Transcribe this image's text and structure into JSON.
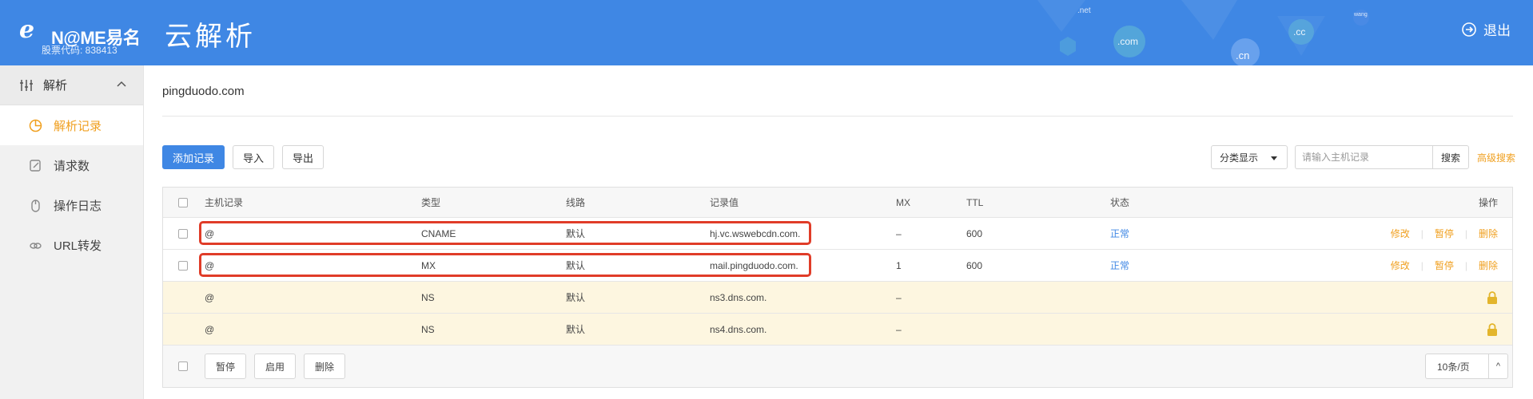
{
  "header": {
    "logo_mark": "e",
    "brand": "N@ME易名",
    "stock_code": "股票代码: 838413",
    "app_title": "云解析",
    "logout": "退出",
    "deco_tlds": [
      ".net",
      ".com",
      ".cc",
      ".cn",
      "wang"
    ]
  },
  "sidebar": {
    "group": "解析",
    "items": [
      {
        "label": "解析记录",
        "icon": "pie-chart-icon",
        "active": true
      },
      {
        "label": "请求数",
        "icon": "edit-icon",
        "active": false
      },
      {
        "label": "操作日志",
        "icon": "mouse-icon",
        "active": false
      },
      {
        "label": "URL转发",
        "icon": "link-icon",
        "active": false
      }
    ]
  },
  "main": {
    "domain": "pingduodo.com",
    "toolbar": {
      "add": "添加记录",
      "import": "导入",
      "export": "导出",
      "view_select": "分类显示",
      "search_placeholder": "请输入主机记录",
      "search": "搜索",
      "advanced": "高级搜索"
    },
    "table": {
      "headers": {
        "host": "主机记录",
        "type": "类型",
        "line": "线路",
        "value": "记录值",
        "mx": "MX",
        "ttl": "TTL",
        "status": "状态",
        "ops": "操作"
      },
      "rows": [
        {
          "host": "@",
          "type": "CNAME",
          "line": "默认",
          "value": "hj.vc.wswebcdn.com.",
          "mx": "–",
          "ttl": "600",
          "status": "正常"
        },
        {
          "host": "@",
          "type": "MX",
          "line": "默认",
          "value": "mail.pingduodo.com.",
          "mx": "1",
          "ttl": "600",
          "status": "正常"
        },
        {
          "host": "@",
          "type": "NS",
          "line": "默认",
          "value": "ns3.dns.com.",
          "mx": "–",
          "ttl": "",
          "status": ""
        },
        {
          "host": "@",
          "type": "NS",
          "line": "默认",
          "value": "ns4.dns.com.",
          "mx": "–",
          "ttl": "",
          "status": ""
        }
      ],
      "ops": {
        "edit": "修改",
        "pause": "暂停",
        "delete": "删除"
      },
      "footer": {
        "pause": "暂停",
        "enable": "启用",
        "delete": "删除",
        "page_size": "10条/页",
        "page_size_toggle": "^"
      }
    }
  },
  "colors": {
    "header_blue": "#3f87e4",
    "accent_orange": "#f0a020",
    "highlight_red": "#e03c28",
    "locked_row": "#fdf6e0"
  }
}
